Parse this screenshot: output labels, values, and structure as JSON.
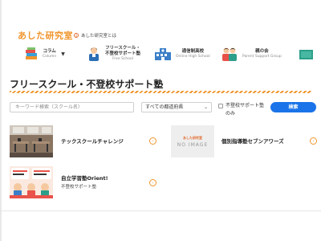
{
  "header": {
    "logo_text": "あした研究室",
    "about_label": "あした研究室とは",
    "about_icon": "info-icon"
  },
  "nav": {
    "items": [
      {
        "label": "コラム",
        "sub": "Column",
        "icon": "books-icon"
      },
      {
        "label": "フリースクール・\n不登校サポート塾",
        "sub": "Free School",
        "icon": "student-icon"
      },
      {
        "label": "通信制高校",
        "sub": "Online High School",
        "icon": "school-building-icon"
      },
      {
        "label": "親の会",
        "sub": "Parent Support Group",
        "icon": "parents-icon"
      }
    ]
  },
  "page": {
    "title": "フリースクール・不登校サポート塾"
  },
  "search": {
    "keyword_placeholder": "キーワード検索（スクール名）",
    "prefecture_value": "すべての都道府県",
    "checkbox_label": "不登校サポート塾のみ",
    "button_label": "検索"
  },
  "cards": [
    {
      "name": "テックスクールチャレンジ",
      "tag": ""
    },
    {
      "name": "個別指導塾セブンアワーズ",
      "tag": "",
      "noimage_brand": "あした研究室",
      "noimage_text": "NO IMAGE"
    },
    {
      "name": "自立学習塾Orient!",
      "tag": "不登校サポート塾"
    }
  ],
  "colors": {
    "brand_orange": "#f0952c",
    "primary_blue": "#1a73e8"
  }
}
